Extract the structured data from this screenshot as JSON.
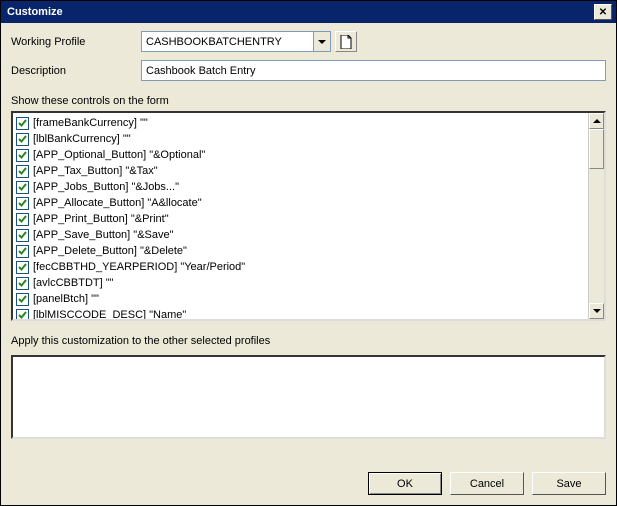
{
  "window": {
    "title": "Customize"
  },
  "labels": {
    "working_profile": "Working Profile",
    "description": "Description",
    "show_controls": "Show these controls on the form",
    "apply_other": "Apply this customization to the other selected profiles"
  },
  "profile": {
    "value": "CASHBOOKBATCHENTRY",
    "description": "Cashbook Batch Entry"
  },
  "controls": [
    {
      "checked": true,
      "name": "[frameBankCurrency]",
      "caption": "\"\""
    },
    {
      "checked": true,
      "name": "[lblBankCurrency]",
      "caption": "\"\""
    },
    {
      "checked": true,
      "name": "[APP_Optional_Button]",
      "caption": "\"&Optional\""
    },
    {
      "checked": true,
      "name": "[APP_Tax_Button]",
      "caption": "\"&Tax\""
    },
    {
      "checked": true,
      "name": "[APP_Jobs_Button]",
      "caption": "\"&Jobs...\""
    },
    {
      "checked": true,
      "name": "[APP_Allocate_Button]",
      "caption": "\"A&llocate\""
    },
    {
      "checked": true,
      "name": "[APP_Print_Button]",
      "caption": "\"&Print\""
    },
    {
      "checked": true,
      "name": "[APP_Save_Button]",
      "caption": "\"&Save\""
    },
    {
      "checked": true,
      "name": "[APP_Delete_Button]",
      "caption": "\"&Delete\""
    },
    {
      "checked": true,
      "name": "[fecCBBTHD_YEARPERIOD]",
      "caption": "\"Year/Period\""
    },
    {
      "checked": true,
      "name": "[avlcCBBTDT]",
      "caption": "\"\""
    },
    {
      "checked": true,
      "name": "[panelBtch]",
      "caption": "\"\""
    },
    {
      "checked": true,
      "name": "[lblMISCCODE_DESC]",
      "caption": "\"Name\""
    }
  ],
  "buttons": {
    "ok": "OK",
    "cancel": "Cancel",
    "save": "Save"
  }
}
